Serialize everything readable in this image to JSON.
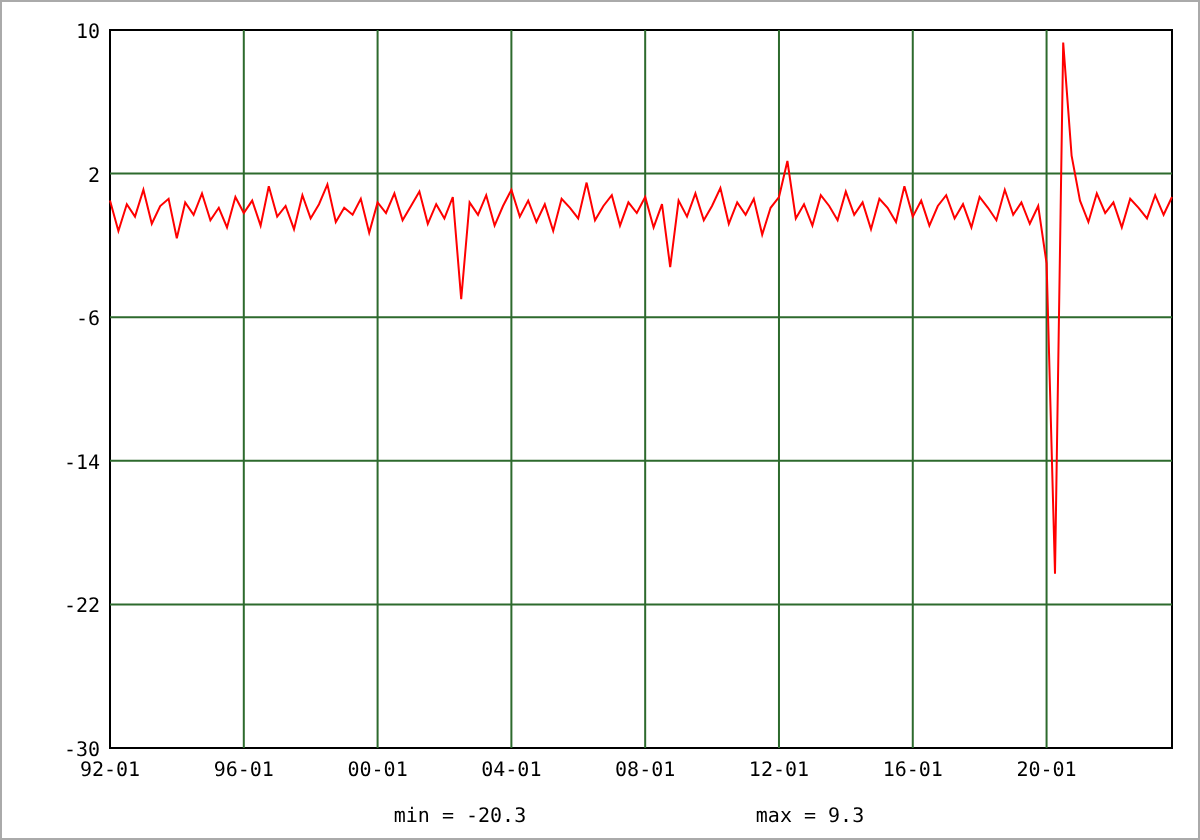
{
  "chart": {
    "min_label": "min = -20.3",
    "max_label": "max = 9.3",
    "chart_data": {
      "type": "line",
      "grid": true,
      "ylim": [
        -30,
        10
      ],
      "yticks": [
        10,
        2,
        -6,
        -14,
        -22,
        -30
      ],
      "categories": [
        "92-01",
        null,
        null,
        null,
        null,
        null,
        null,
        null,
        null,
        null,
        null,
        null,
        null,
        null,
        null,
        null,
        "96-01",
        null,
        null,
        null,
        null,
        null,
        null,
        null,
        null,
        null,
        null,
        null,
        null,
        null,
        null,
        null,
        "00-01",
        null,
        null,
        null,
        null,
        null,
        null,
        null,
        null,
        null,
        null,
        null,
        null,
        null,
        null,
        null,
        "04-01",
        null,
        null,
        null,
        null,
        null,
        null,
        null,
        null,
        null,
        null,
        null,
        null,
        null,
        null,
        null,
        "08-01",
        null,
        null,
        null,
        null,
        null,
        null,
        null,
        null,
        null,
        null,
        null,
        null,
        null,
        null,
        null,
        "12-01",
        null,
        null,
        null,
        null,
        null,
        null,
        null,
        null,
        null,
        null,
        null,
        null,
        null,
        null,
        null,
        "16-01",
        null,
        null,
        null,
        null,
        null,
        null,
        null,
        null,
        null,
        null,
        null,
        null,
        null,
        null,
        null,
        "20-01",
        null,
        null,
        null,
        null,
        null,
        null,
        null,
        null,
        null,
        null,
        null,
        null,
        null,
        null,
        null
      ],
      "series": [
        {
          "color": "#ff0000",
          "values": [
            0.5,
            -1.2,
            0.3,
            -0.4,
            1.1,
            -0.8,
            0.2,
            0.6,
            -1.6,
            0.4,
            -0.3,
            0.9,
            -0.6,
            0.1,
            -1.0,
            0.7,
            -0.2,
            0.5,
            -0.9,
            1.3,
            -0.4,
            0.2,
            -1.1,
            0.8,
            -0.5,
            0.3,
            1.4,
            -0.7,
            0.1,
            -0.3,
            0.6,
            -1.3,
            0.4,
            -0.2,
            0.9,
            -0.6,
            0.2,
            1.0,
            -0.8,
            0.3,
            -0.5,
            0.7,
            -5.0,
            0.4,
            -0.3,
            0.8,
            -0.9,
            0.2,
            1.1,
            -0.4,
            0.5,
            -0.7,
            0.3,
            -1.2,
            0.6,
            0.1,
            -0.5,
            1.5,
            -0.6,
            0.2,
            0.8,
            -0.9,
            0.4,
            -0.2,
            0.7,
            -1.0,
            0.3,
            -3.2,
            0.5,
            -0.4,
            0.9,
            -0.6,
            0.2,
            1.2,
            -0.8,
            0.4,
            -0.3,
            0.6,
            -1.4,
            0.1,
            0.7,
            2.7,
            -0.5,
            0.3,
            -0.9,
            0.8,
            0.2,
            -0.6,
            1.0,
            -0.3,
            0.4,
            -1.1,
            0.6,
            0.1,
            -0.7,
            1.3,
            -0.4,
            0.5,
            -0.9,
            0.2,
            0.8,
            -0.5,
            0.3,
            -1.0,
            0.7,
            0.1,
            -0.6,
            1.1,
            -0.3,
            0.4,
            -0.8,
            0.2,
            -3.0,
            -20.3,
            9.3,
            3.0,
            0.5,
            -0.7,
            0.9,
            -0.2,
            0.4,
            -1.0,
            0.6,
            0.1,
            -0.5,
            0.8,
            -0.3,
            0.7
          ]
        }
      ]
    }
  }
}
